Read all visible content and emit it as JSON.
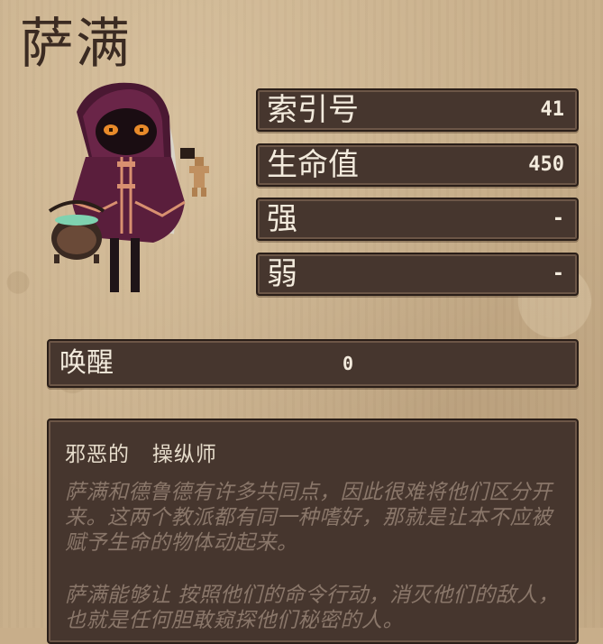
{
  "character": {
    "name": "萨满"
  },
  "stats": [
    {
      "label": "索引号",
      "value": "41"
    },
    {
      "label": "生命值",
      "value": "450"
    },
    {
      "label": "强",
      "value": "-"
    },
    {
      "label": "弱",
      "value": "-"
    }
  ],
  "awaken": {
    "label": "唤醒",
    "value": "0"
  },
  "description": {
    "heading": "邪恶的   操纵师",
    "paragraphs": [
      "萨满和德鲁德有许多共同点，因此很难将他们区分开来。这两个教派都有同一种嗜好，那就是让本不应被赋予生命的物体动起来。",
      "萨满能够让  按照他们的命令行动，消灭他们的敌人，也就是任何胆敢窥探他们秘密的人。"
    ]
  },
  "colors": {
    "panel": "#46362e",
    "panel_border": "#2a1e18",
    "text_light": "#f3ebdd",
    "text_muted": "#8a776a",
    "parchment": "#c9b08c",
    "cloak": "#5a1e3c",
    "eyes": "#e88a2a"
  },
  "icons": {
    "portrait": "shaman-hooded-figure"
  }
}
